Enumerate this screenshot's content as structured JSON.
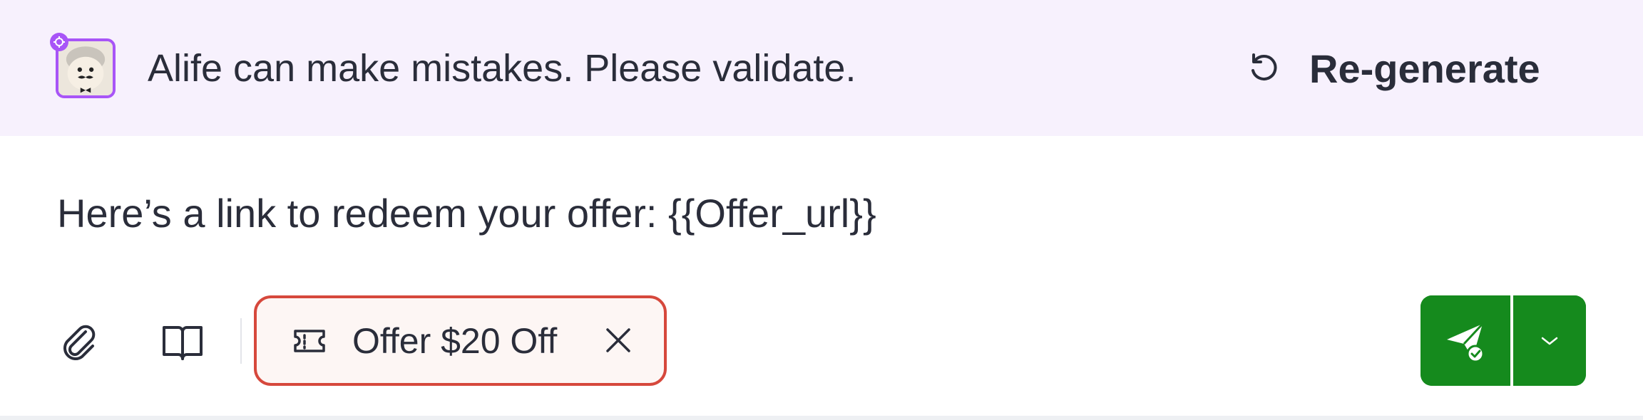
{
  "banner": {
    "notice": "Alife can make mistakes. Please validate.",
    "regenerate_label": "Re-generate",
    "background": "#f7f1fd",
    "avatar_border": "#a855f7"
  },
  "composer": {
    "message": "Here’s a link to redeem your offer: {{Offer_url}}"
  },
  "toolbar": {
    "attach_icon": "paperclip-icon",
    "knowledge_icon": "book-icon",
    "offer_chip": {
      "label": "Offer $20 Off",
      "icon": "ticket-icon",
      "border_color": "#d6483c"
    },
    "send": {
      "icon": "paper-plane-check-icon",
      "dropdown_icon": "chevron-down-icon",
      "color": "#158a1d"
    }
  }
}
